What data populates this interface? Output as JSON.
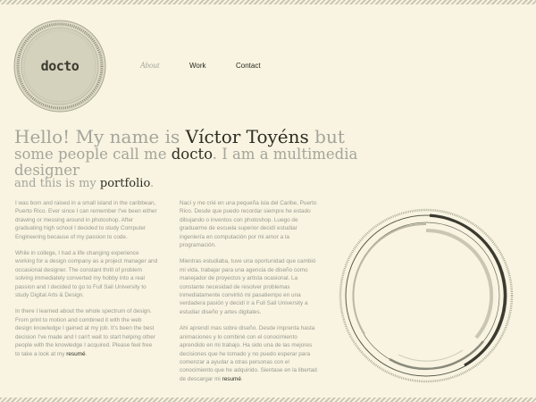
{
  "logo": {
    "text": "docto"
  },
  "nav": {
    "about": "About",
    "work": "Work",
    "contact": "Contact"
  },
  "hero": {
    "l1a": "Hello! My name is ",
    "l1b": "Víctor Toyéns",
    "l1c": " but",
    "l2a": "some people call me ",
    "l2b": "docto",
    "l2c": ". I am a multimedia designer",
    "l3a": "and this is my ",
    "l3b": "portfolio",
    "l3c": "."
  },
  "col1": {
    "p1": "I was born and raised in a small island in the caribbean, Puerto Rico. Ever since I can remember I've been either drawing or messing around in photoshop. After graduating high school I decided to study Computer Engineering because of my passion to code.",
    "p2": "While in college, I had a life changing experience working for a design company as a project manager and occasional designer. The constant thrill of problem solving immediately converted my hobby into a real passion and I decided to go to Full Sail University to study Digital Arts & Design.",
    "p3": "In there I learned about the whole spectrum of design. From print to motion and combined it with the web design knowledge I gained at my job. It's been the best decision I've made and I can't wait to start helping other people with the knowledge I acquired. Please feel free to take a look at my ",
    "p3link": "resumé",
    "p3end": "."
  },
  "col2": {
    "p1": "Nací y me crié en una pequeña isla del Caribe, Puerto Rico. Desde que puedo recordar siempre he estado dibujando o inventos con photoshop. Luego de graduarme de escuela superior decidí estudiar ingeniería en computación por mi amor a la programación.",
    "p2": "Mientras estudiaba, tuve una oportunidad que cambió mi vida, trabajar para una agencia de diseño como manejador de proyectos y artista ocasional. La constante necesidad de resolver problemas inmediatamente convirtió mi pasatiempo en una verdadera pasión y decidí ir a Full Sail University a estudiar diseño y artes digitales.",
    "p3": "Ahí aprendí mas sobre diseño. Desde imprenta hasta animaciones y lo combiné con el conocimiento aprendido en mi trabajo. Ha sido una de las mejores decisiones que he tomado y no puedo esperar para comenzar a ayudar a otras personas con el conocimiento que he adquirido. Sientase en la libertad de descargar mi ",
    "p3link": "resumé",
    "p3end": "."
  },
  "colors": {
    "background": "#f8f4e1",
    "dark": "#2e2e24",
    "muted": "#a5a59b"
  }
}
